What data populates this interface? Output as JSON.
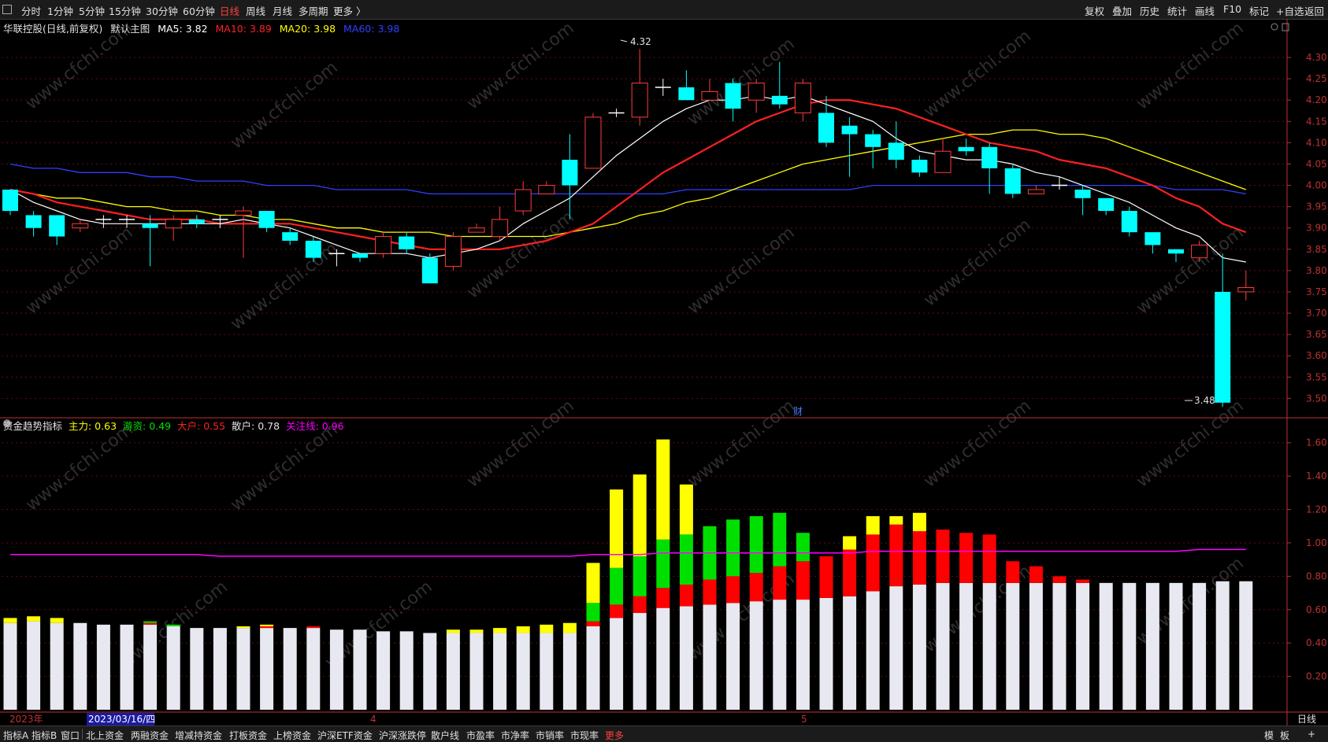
{
  "toolbar": {
    "periods": [
      "分时",
      "1分钟",
      "5分钟",
      "15分钟",
      "30分钟",
      "60分钟",
      "日线",
      "周线",
      "月线",
      "多周期",
      "更多 〉"
    ],
    "active_period": "日线",
    "right_buttons": [
      "复权",
      "叠加",
      "历史",
      "统计",
      "画线",
      "F10",
      "标记",
      "+自选",
      "返回"
    ]
  },
  "main_chart": {
    "stock_title": "华联控股(日线,前复权)",
    "theme": "默认主图",
    "ma5": "MA5: 3.82",
    "ma10": "MA10: 3.89",
    "ma20": "MA20: 3.98",
    "ma60": "MA60: 3.98",
    "high_label": "4.32",
    "low_label": "3.48",
    "cai_marker": "财",
    "watermark": "www.cfchi.com"
  },
  "indicator": {
    "name": "资金趋势指标",
    "zhuli": "主力: 0.63",
    "youzi": "游资: 0.49",
    "dahu": "大户: 0.55",
    "sanhu": "散户: 0.78",
    "guanzhu": "关注线: 0.96"
  },
  "time_axis": {
    "year_label": "2023年",
    "cursor_date": "2023/03/16/四",
    "month_4": "4",
    "month_5": "5",
    "period_label": "日线"
  },
  "bottom_tabs": [
    "指标A",
    "指标B",
    "窗口",
    "北上资金",
    "两融资金",
    "增减持资金",
    "打板资金",
    "上榜资金",
    "沪深ETF资金",
    "沪深涨跌停",
    "散户线",
    "市盈率",
    "市净率",
    "市销率",
    "市现率",
    "更多"
  ],
  "bottom_right": [
    "模",
    "板",
    "+"
  ],
  "colors": {
    "up": "#ff3b3b",
    "down": "#00ffff",
    "ma5": "#ffffff",
    "ma10": "#ff2020",
    "ma20": "#ffff00",
    "ma60": "#3040ff",
    "sanhu": "#e8e8f0",
    "dahu": "#ff0000",
    "youzi": "#00e000",
    "zhuli": "#ffff00",
    "guanzhu": "#ff00ff",
    "axis": "#c03030"
  },
  "chart_data": [
    {
      "type": "candlestick",
      "y_ticks": [
        "4.30",
        "4.25",
        "4.20",
        "4.15",
        "4.10",
        "4.05",
        "4.00",
        "3.95",
        "3.90",
        "3.85",
        "3.80",
        "3.75",
        "3.70",
        "3.65",
        "3.60",
        "3.55",
        "3.50"
      ],
      "ylim": [
        3.46,
        4.35
      ],
      "candles": [
        [
          3.99,
          3.94,
          3.99,
          3.93
        ],
        [
          3.93,
          3.9,
          3.94,
          3.88
        ],
        [
          3.93,
          3.88,
          3.93,
          3.86
        ],
        [
          3.9,
          3.91,
          3.92,
          3.89
        ],
        [
          3.92,
          3.92,
          3.93,
          3.9
        ],
        [
          3.92,
          3.92,
          3.93,
          3.9
        ],
        [
          3.91,
          3.9,
          3.93,
          3.81
        ],
        [
          3.9,
          3.92,
          3.93,
          3.87
        ],
        [
          3.92,
          3.91,
          3.93,
          3.9
        ],
        [
          3.92,
          3.92,
          3.93,
          3.9
        ],
        [
          3.93,
          3.94,
          3.95,
          3.83
        ],
        [
          3.94,
          3.9,
          3.94,
          3.89
        ],
        [
          3.89,
          3.87,
          3.9,
          3.86
        ],
        [
          3.87,
          3.83,
          3.88,
          3.82
        ],
        [
          3.84,
          3.84,
          3.85,
          3.81
        ],
        [
          3.84,
          3.83,
          3.84,
          3.82
        ],
        [
          3.84,
          3.88,
          3.89,
          3.83
        ],
        [
          3.88,
          3.85,
          3.89,
          3.84
        ],
        [
          3.83,
          3.77,
          3.84,
          3.77
        ],
        [
          3.81,
          3.88,
          3.89,
          3.8
        ],
        [
          3.89,
          3.9,
          3.91,
          3.89
        ],
        [
          3.88,
          3.92,
          3.95,
          3.87
        ],
        [
          3.94,
          3.99,
          4.01,
          3.93
        ],
        [
          3.98,
          4.0,
          4.01,
          3.98
        ],
        [
          4.06,
          4.0,
          4.12,
          3.92
        ],
        [
          4.04,
          4.16,
          4.17,
          4.04
        ],
        [
          4.17,
          4.17,
          4.18,
          4.16
        ],
        [
          4.16,
          4.24,
          4.32,
          4.14
        ],
        [
          4.23,
          4.23,
          4.25,
          4.21
        ],
        [
          4.23,
          4.2,
          4.27,
          4.2
        ],
        [
          4.2,
          4.22,
          4.25,
          4.2
        ],
        [
          4.24,
          4.18,
          4.25,
          4.15
        ],
        [
          4.2,
          4.24,
          4.25,
          4.17
        ],
        [
          4.21,
          4.19,
          4.29,
          4.18
        ],
        [
          4.17,
          4.24,
          4.25,
          4.15
        ],
        [
          4.17,
          4.1,
          4.21,
          4.09
        ],
        [
          4.14,
          4.12,
          4.16,
          4.02
        ],
        [
          4.12,
          4.09,
          4.13,
          4.04
        ],
        [
          4.1,
          4.06,
          4.15,
          4.04
        ],
        [
          4.06,
          4.03,
          4.07,
          4.02
        ],
        [
          4.03,
          4.08,
          4.11,
          4.03
        ],
        [
          4.09,
          4.08,
          4.11,
          4.07
        ],
        [
          4.09,
          4.04,
          4.1,
          3.98
        ],
        [
          4.04,
          3.98,
          4.05,
          3.97
        ],
        [
          3.98,
          3.99,
          4.0,
          3.98
        ],
        [
          4.0,
          4.0,
          4.02,
          3.99
        ],
        [
          3.99,
          3.97,
          4.0,
          3.93
        ],
        [
          3.97,
          3.94,
          3.97,
          3.93
        ],
        [
          3.94,
          3.89,
          3.95,
          3.88
        ],
        [
          3.89,
          3.86,
          3.89,
          3.84
        ],
        [
          3.85,
          3.84,
          3.85,
          3.82
        ],
        [
          3.83,
          3.86,
          3.87,
          3.82
        ],
        [
          3.75,
          3.49,
          3.84,
          3.48
        ],
        [
          3.75,
          3.76,
          3.8,
          3.73
        ]
      ],
      "ma5": [
        3.99,
        3.96,
        3.94,
        3.92,
        3.91,
        3.91,
        3.91,
        3.91,
        3.91,
        3.91,
        3.92,
        3.91,
        3.9,
        3.88,
        3.86,
        3.84,
        3.84,
        3.84,
        3.83,
        3.84,
        3.85,
        3.87,
        3.91,
        3.94,
        3.97,
        4.02,
        4.07,
        4.11,
        4.15,
        4.18,
        4.2,
        4.2,
        4.21,
        4.2,
        4.21,
        4.19,
        4.17,
        4.15,
        4.11,
        4.08,
        4.07,
        4.06,
        4.06,
        4.05,
        4.03,
        4.02,
        4.0,
        3.98,
        3.96,
        3.93,
        3.9,
        3.88,
        3.83,
        3.82
      ],
      "ma10": [
        3.99,
        3.98,
        3.96,
        3.95,
        3.94,
        3.93,
        3.92,
        3.92,
        3.92,
        3.91,
        3.91,
        3.91,
        3.91,
        3.9,
        3.89,
        3.88,
        3.87,
        3.86,
        3.85,
        3.85,
        3.85,
        3.85,
        3.86,
        3.87,
        3.89,
        3.91,
        3.95,
        3.99,
        4.03,
        4.06,
        4.09,
        4.12,
        4.15,
        4.17,
        4.19,
        4.2,
        4.2,
        4.19,
        4.18,
        4.16,
        4.14,
        4.12,
        4.1,
        4.09,
        4.08,
        4.06,
        4.05,
        4.04,
        4.02,
        4.0,
        3.97,
        3.95,
        3.91,
        3.89
      ],
      "ma20": [
        3.99,
        3.98,
        3.97,
        3.97,
        3.96,
        3.95,
        3.95,
        3.94,
        3.94,
        3.93,
        3.93,
        3.92,
        3.92,
        3.91,
        3.9,
        3.9,
        3.89,
        3.89,
        3.89,
        3.88,
        3.88,
        3.88,
        3.88,
        3.88,
        3.89,
        3.9,
        3.91,
        3.93,
        3.94,
        3.96,
        3.97,
        3.99,
        4.01,
        4.03,
        4.05,
        4.06,
        4.07,
        4.08,
        4.09,
        4.1,
        4.11,
        4.12,
        4.12,
        4.13,
        4.13,
        4.12,
        4.12,
        4.11,
        4.09,
        4.07,
        4.05,
        4.03,
        4.01,
        3.99
      ],
      "ma60": [
        4.05,
        4.04,
        4.04,
        4.03,
        4.03,
        4.03,
        4.02,
        4.02,
        4.01,
        4.01,
        4.01,
        4.0,
        4.0,
        4.0,
        3.99,
        3.99,
        3.99,
        3.99,
        3.98,
        3.98,
        3.98,
        3.98,
        3.98,
        3.98,
        3.98,
        3.98,
        3.98,
        3.98,
        3.98,
        3.99,
        3.99,
        3.99,
        3.99,
        3.99,
        3.99,
        3.99,
        3.99,
        4.0,
        4.0,
        4.0,
        4.0,
        4.0,
        4.0,
        4.0,
        4.0,
        4.0,
        4.0,
        4.0,
        4.0,
        4.0,
        3.99,
        3.99,
        3.99,
        3.98
      ]
    },
    {
      "type": "bar",
      "name": "资金趋势指标",
      "y_ticks": [
        "1.60",
        "1.40",
        "1.20",
        "1.00",
        "0.80",
        "0.60",
        "0.40",
        "0.20"
      ],
      "ylim": [
        0,
        1.66
      ],
      "series": [
        {
          "name": "散户",
          "values": [
            0.52,
            0.53,
            0.52,
            0.52,
            0.51,
            0.51,
            0.51,
            0.5,
            0.49,
            0.49,
            0.49,
            0.49,
            0.49,
            0.49,
            0.48,
            0.48,
            0.47,
            0.47,
            0.46,
            0.46,
            0.46,
            0.46,
            0.46,
            0.46,
            0.46,
            0.5,
            0.55,
            0.58,
            0.61,
            0.62,
            0.63,
            0.64,
            0.65,
            0.66,
            0.66,
            0.67,
            0.68,
            0.71,
            0.74,
            0.75,
            0.76,
            0.76,
            0.76,
            0.76,
            0.76,
            0.76,
            0.76,
            0.76,
            0.76,
            0.76,
            0.76,
            0.76,
            0.77,
            0.77
          ]
        },
        {
          "name": "大户",
          "values": [
            0.52,
            0.53,
            0.52,
            0.52,
            0.51,
            0.51,
            0.52,
            0.5,
            0.49,
            0.49,
            0.49,
            0.5,
            0.49,
            0.5,
            0.48,
            0.48,
            0.47,
            0.47,
            0.46,
            0.46,
            0.46,
            0.46,
            0.46,
            0.46,
            0.46,
            0.53,
            0.63,
            0.68,
            0.73,
            0.75,
            0.78,
            0.8,
            0.82,
            0.86,
            0.89,
            0.92,
            0.96,
            1.05,
            1.11,
            1.07,
            1.08,
            1.06,
            1.05,
            0.89,
            0.86,
            0.8,
            0.78,
            0.76,
            0.76,
            0.76,
            0.76,
            0.76,
            0.77,
            0.77
          ]
        },
        {
          "name": "游资",
          "values": [
            0.52,
            0.53,
            0.52,
            0.52,
            0.51,
            0.51,
            0.53,
            0.51,
            0.49,
            0.49,
            0.49,
            0.5,
            0.49,
            0.5,
            0.48,
            0.48,
            0.47,
            0.47,
            0.46,
            0.46,
            0.46,
            0.46,
            0.46,
            0.46,
            0.46,
            0.64,
            0.85,
            0.92,
            1.02,
            1.05,
            1.1,
            1.14,
            1.16,
            1.18,
            1.06,
            0.92,
            0.96,
            1.05,
            1.11,
            1.07,
            1.08,
            1.06,
            1.05,
            0.89,
            0.86,
            0.8,
            0.78,
            0.76,
            0.76,
            0.76,
            0.76,
            0.76,
            0.77,
            0.77
          ]
        },
        {
          "name": "主力",
          "values": [
            0.55,
            0.56,
            0.55,
            0.52,
            0.51,
            0.51,
            0.53,
            0.51,
            0.49,
            0.49,
            0.5,
            0.51,
            0.49,
            0.5,
            0.48,
            0.48,
            0.47,
            0.47,
            0.46,
            0.48,
            0.48,
            0.49,
            0.5,
            0.51,
            0.52,
            0.88,
            1.32,
            1.41,
            1.62,
            1.35,
            1.1,
            1.14,
            1.16,
            1.18,
            1.06,
            0.92,
            1.04,
            1.16,
            1.16,
            1.18,
            1.08,
            1.06,
            1.05,
            0.89,
            0.86,
            0.8,
            0.78,
            0.76,
            0.76,
            0.76,
            0.76,
            0.76,
            0.77,
            0.77
          ]
        },
        {
          "name": "关注线",
          "values": [
            0.93,
            0.93,
            0.93,
            0.93,
            0.93,
            0.93,
            0.93,
            0.93,
            0.93,
            0.92,
            0.92,
            0.92,
            0.92,
            0.92,
            0.92,
            0.92,
            0.92,
            0.92,
            0.92,
            0.92,
            0.92,
            0.92,
            0.92,
            0.92,
            0.92,
            0.93,
            0.93,
            0.93,
            0.94,
            0.94,
            0.94,
            0.94,
            0.94,
            0.94,
            0.94,
            0.94,
            0.94,
            0.95,
            0.95,
            0.95,
            0.95,
            0.95,
            0.95,
            0.95,
            0.95,
            0.95,
            0.95,
            0.95,
            0.95,
            0.95,
            0.95,
            0.96,
            0.96,
            0.96
          ]
        }
      ]
    }
  ]
}
